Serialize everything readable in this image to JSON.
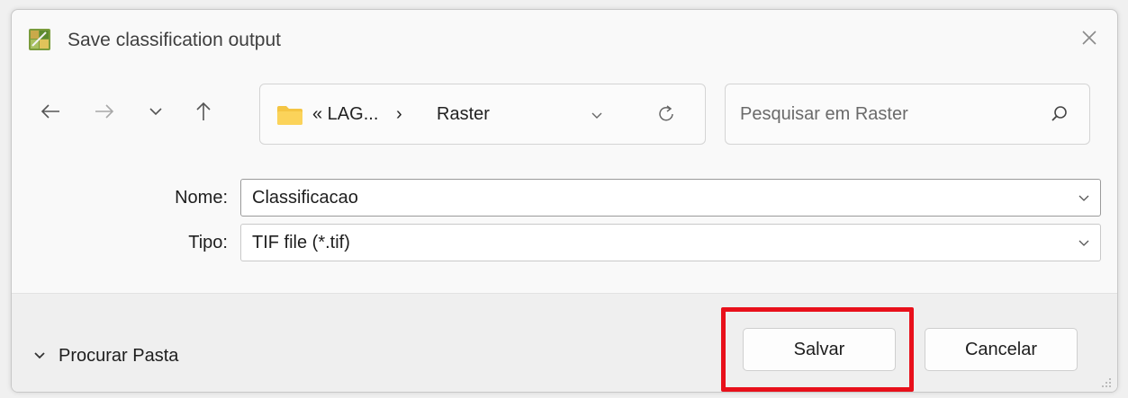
{
  "window": {
    "title": "Save classification output",
    "app_icon": "qgis-app-icon",
    "close_icon": "close-icon"
  },
  "nav": {
    "back_icon": "arrow-left-icon",
    "forward_icon": "arrow-right-icon",
    "recent_icon": "chevron-down-icon",
    "up_icon": "arrow-up-icon",
    "breadcrumb": {
      "folder_icon": "folder-icon",
      "prefix": "« LAG...",
      "separator": "›",
      "current": "Raster"
    },
    "refresh_icon": "refresh-icon"
  },
  "search": {
    "placeholder": "Pesquisar em Raster",
    "icon": "search-icon"
  },
  "form": {
    "name_label": "Nome:",
    "name_value": "Classificacao",
    "type_label": "Tipo:",
    "type_value": "TIF file (*.tif)"
  },
  "footer": {
    "browse_label": "Procurar Pasta",
    "save_label": "Salvar",
    "cancel_label": "Cancelar"
  },
  "colors": {
    "highlight": "#e8101b",
    "folder": "#f4c543"
  }
}
